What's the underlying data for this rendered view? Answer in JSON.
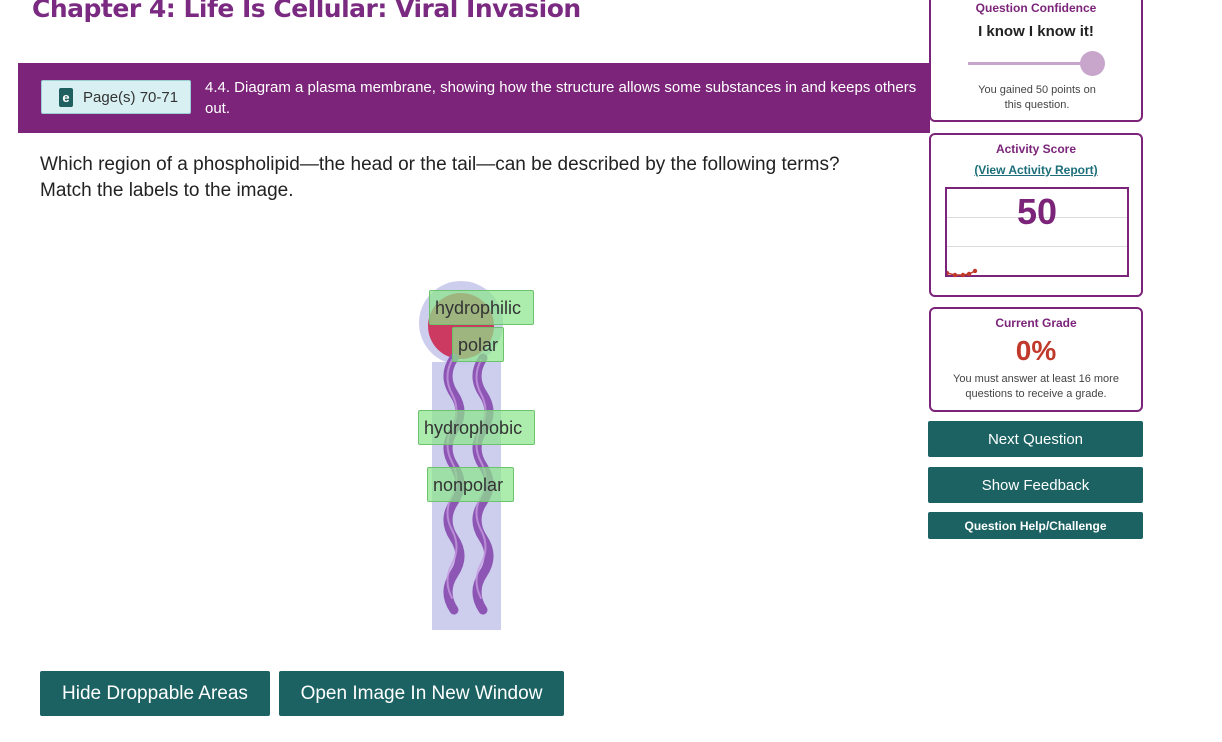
{
  "header": {
    "chapter_title": "Chapter 4: Life Is Cellular: Viral Invasion"
  },
  "objective": {
    "page_ref": "Page(s) 70-71",
    "ebook_icon": "ebook-icon",
    "text": "4.4. Diagram a plasma membrane, showing how the structure allows some substances in and keeps others out."
  },
  "question": {
    "line1": "Which region of a phospholipid—the head or the tail—can be described by the following terms?",
    "line2": "Match the labels to the image."
  },
  "labels": {
    "hydrophilic": "hydrophilic",
    "polar": "polar",
    "hydrophobic": "hydrophobic",
    "nonpolar": "nonpolar"
  },
  "buttons": {
    "hide_droppable": "Hide Droppable Areas",
    "open_image": "Open Image In New Window"
  },
  "sidebar": {
    "confidence": {
      "title": "Question Confidence",
      "choice": "I know I know it!",
      "level": 1.0,
      "note": "You gained 50 points on this question."
    },
    "activity": {
      "title": "Activity Score",
      "link": "(View Activity Report)",
      "score": "50"
    },
    "grade": {
      "title": "Current Grade",
      "value": "0%",
      "note": "You must answer at least 16 more questions to receive a grade."
    },
    "next_question": "Next Question",
    "show_feedback": "Show Feedback",
    "help": "Question Help/Challenge"
  },
  "colors": {
    "brand_purple": "#7b2479",
    "button_teal": "#1c6262",
    "grade_red": "#c0392b",
    "label_green": "#8ce48c"
  }
}
